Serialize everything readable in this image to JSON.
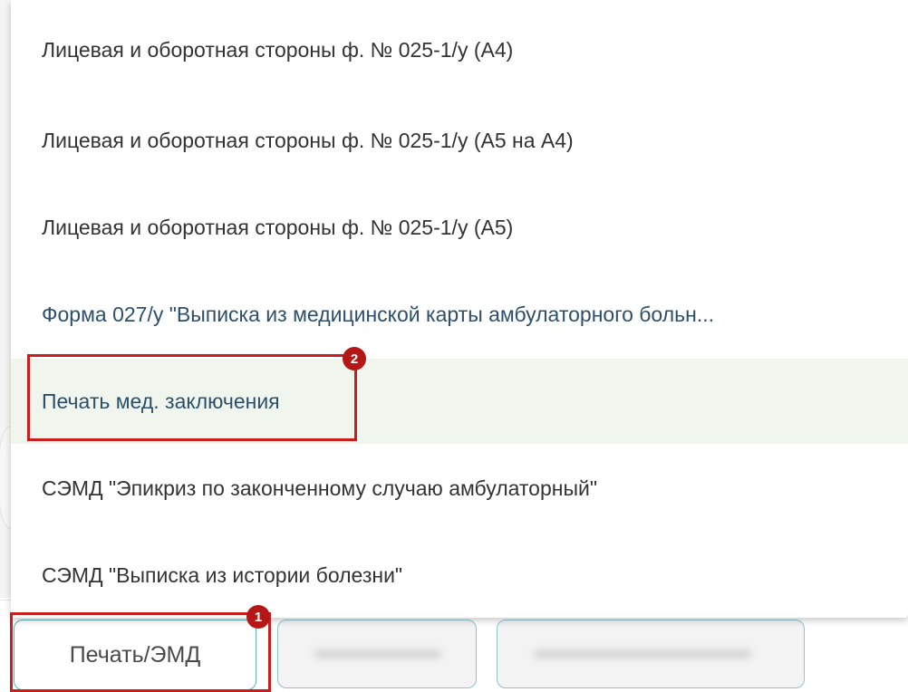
{
  "menu": {
    "items": [
      {
        "label": "Лицевая и оборотная стороны ф. № 025-1/у (А4)"
      },
      {
        "label": "Лицевая и оборотная стороны ф. № 025-1/у (А5 на А4)"
      },
      {
        "label": "Лицевая и оборотная стороны ф. № 025-1/у (А5)"
      },
      {
        "label": "Форма 027/у \"Выписка из медицинской карты амбулаторного больн..."
      },
      {
        "label": "Печать мед. заключения"
      },
      {
        "label": "СЭМД \"Эпикриз по законченному случаю амбулаторный\""
      },
      {
        "label": "СЭМД \"Выписка из истории болезни\""
      }
    ]
  },
  "toolbar": {
    "print_button_label": "Печать/ЭМД"
  },
  "annotations": {
    "marker1": "1",
    "marker2": "2"
  },
  "colors": {
    "highlight": "#f0f6ee",
    "marker": "#c81e1e",
    "button_border": "#5fb0bb",
    "link_text": "#2d4f6b"
  }
}
